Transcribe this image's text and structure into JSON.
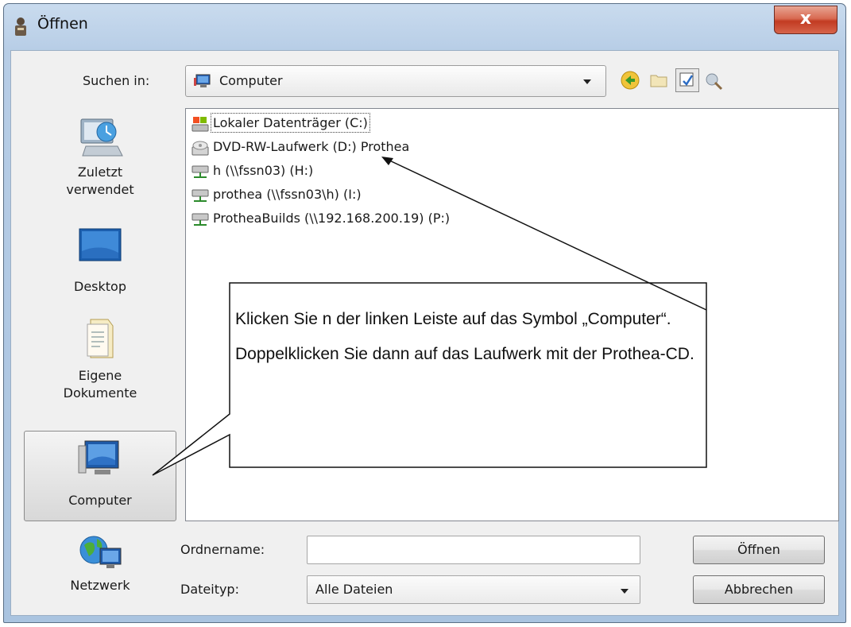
{
  "window": {
    "title": "Öffnen",
    "close_glyph": "x"
  },
  "lookin": {
    "label": "Suchen in:",
    "value": "Computer"
  },
  "places": [
    {
      "label_line1": "Zuletzt",
      "label_line2": "verwendet",
      "icon": "recent-icon"
    },
    {
      "label_line1": "Desktop",
      "label_line2": "",
      "icon": "desktop-icon"
    },
    {
      "label_line1": "Eigene",
      "label_line2": "Dokumente",
      "icon": "documents-icon"
    },
    {
      "label_line1": "Computer",
      "label_line2": "",
      "icon": "computer-icon"
    },
    {
      "label_line1": "Netzwerk",
      "label_line2": "",
      "icon": "network-icon"
    }
  ],
  "files": [
    {
      "name": "Lokaler Datenträger (C:)",
      "icon": "local-disk-icon"
    },
    {
      "name": "DVD-RW-Laufwerk (D:) Prothea",
      "icon": "dvd-drive-icon"
    },
    {
      "name": "h (\\\\fssn03) (H:)",
      "icon": "network-drive-icon"
    },
    {
      "name": "prothea (\\\\fssn03\\h) (I:)",
      "icon": "network-drive-icon"
    },
    {
      "name": "ProtheaBuilds (\\\\192.168.200.19) (P:)",
      "icon": "network-drive-icon"
    }
  ],
  "callout": {
    "para1": "Klicken Sie n der linken Leiste auf das Symbol „Computer“.",
    "para2": "Doppelklicken Sie dann auf das Laufwerk mit der Prothea-CD."
  },
  "folder_name": {
    "label": "Ordnername:",
    "value": ""
  },
  "file_type": {
    "label": "Dateityp:",
    "value": "Alle Dateien"
  },
  "buttons": {
    "open": "Öffnen",
    "cancel": "Abbrechen"
  },
  "colors": {
    "title_bg": "#b7cde6",
    "close": "#c23b22",
    "client_bg": "#f0f0f0"
  }
}
